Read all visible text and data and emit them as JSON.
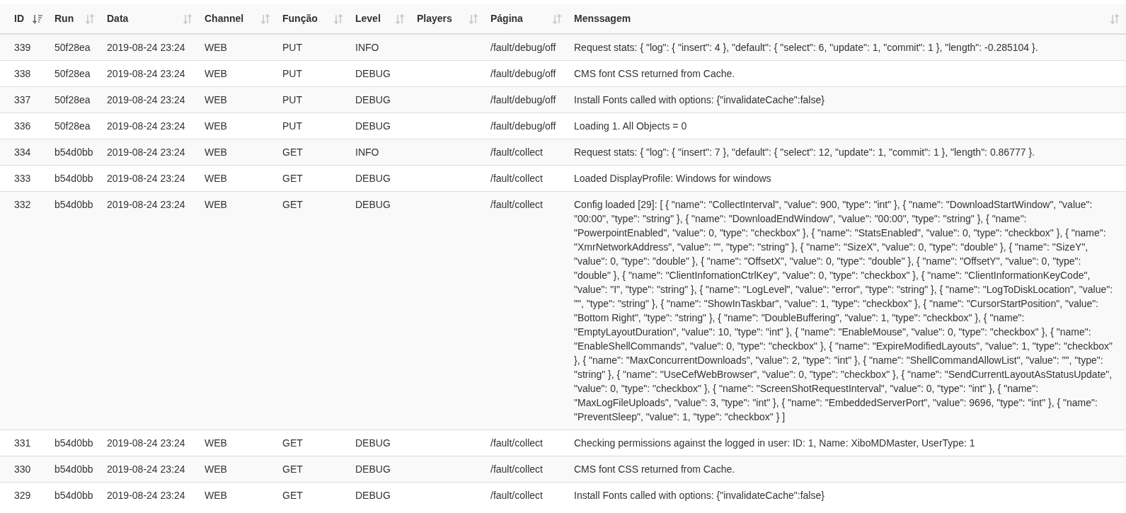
{
  "table": {
    "columns": [
      {
        "label": "ID",
        "sorted": true
      },
      {
        "label": "Run",
        "sorted": false
      },
      {
        "label": "Data",
        "sorted": false
      },
      {
        "label": "Channel",
        "sorted": false
      },
      {
        "label": "Função",
        "sorted": false
      },
      {
        "label": "Level",
        "sorted": false
      },
      {
        "label": "Players",
        "sorted": false
      },
      {
        "label": "Página",
        "sorted": false
      },
      {
        "label": "Menssagem",
        "sorted": false
      }
    ],
    "rows": [
      {
        "cells": [
          "339",
          "50f28ea",
          "2019-08-24 23:24",
          "WEB",
          "PUT",
          "INFO",
          "",
          "/fault/debug/off",
          "Request stats: { \"log\": { \"insert\": 4 }, \"default\": { \"select\": 6, \"update\": 1, \"commit\": 1 }, \"length\": -0.285104 }."
        ]
      },
      {
        "cells": [
          "338",
          "50f28ea",
          "2019-08-24 23:24",
          "WEB",
          "PUT",
          "DEBUG",
          "",
          "/fault/debug/off",
          "CMS font CSS returned from Cache."
        ]
      },
      {
        "cells": [
          "337",
          "50f28ea",
          "2019-08-24 23:24",
          "WEB",
          "PUT",
          "DEBUG",
          "",
          "/fault/debug/off",
          "Install Fonts called with options: {\"invalidateCache\":false}"
        ]
      },
      {
        "cells": [
          "336",
          "50f28ea",
          "2019-08-24 23:24",
          "WEB",
          "PUT",
          "DEBUG",
          "",
          "/fault/debug/off",
          "Loading 1. All Objects = 0"
        ]
      },
      {
        "cells": [
          "334",
          "b54d0bb",
          "2019-08-24 23:24",
          "WEB",
          "GET",
          "INFO",
          "",
          "/fault/collect",
          "Request stats: { \"log\": { \"insert\": 7 }, \"default\": { \"select\": 12, \"update\": 1, \"commit\": 1 }, \"length\": 0.86777 }."
        ]
      },
      {
        "cells": [
          "333",
          "b54d0bb",
          "2019-08-24 23:24",
          "WEB",
          "GET",
          "DEBUG",
          "",
          "/fault/collect",
          "Loaded DisplayProfile: Windows for windows"
        ]
      },
      {
        "cells": [
          "332",
          "b54d0bb",
          "2019-08-24 23:24",
          "WEB",
          "GET",
          "DEBUG",
          "",
          "/fault/collect",
          "Config loaded [29]: [ { \"name\": \"CollectInterval\", \"value\": 900, \"type\": \"int\" }, { \"name\": \"DownloadStartWindow\", \"value\": \"00:00\", \"type\": \"string\" }, { \"name\": \"DownloadEndWindow\", \"value\": \"00:00\", \"type\": \"string\" }, { \"name\": \"PowerpointEnabled\", \"value\": 0, \"type\": \"checkbox\" }, { \"name\": \"StatsEnabled\", \"value\": 0, \"type\": \"checkbox\" }, { \"name\": \"XmrNetworkAddress\", \"value\": \"\", \"type\": \"string\" }, { \"name\": \"SizeX\", \"value\": 0, \"type\": \"double\" }, { \"name\": \"SizeY\", \"value\": 0, \"type\": \"double\" }, { \"name\": \"OffsetX\", \"value\": 0, \"type\": \"double\" }, { \"name\": \"OffsetY\", \"value\": 0, \"type\": \"double\" }, { \"name\": \"ClientInfomationCtrlKey\", \"value\": 0, \"type\": \"checkbox\" }, { \"name\": \"ClientInformationKeyCode\", \"value\": \"I\", \"type\": \"string\" }, { \"name\": \"LogLevel\", \"value\": \"error\", \"type\": \"string\" }, { \"name\": \"LogToDiskLocation\", \"value\": \"\", \"type\": \"string\" }, { \"name\": \"ShowInTaskbar\", \"value\": 1, \"type\": \"checkbox\" }, { \"name\": \"CursorStartPosition\", \"value\": \"Bottom Right\", \"type\": \"string\" }, { \"name\": \"DoubleBuffering\", \"value\": 1, \"type\": \"checkbox\" }, { \"name\": \"EmptyLayoutDuration\", \"value\": 10, \"type\": \"int\" }, { \"name\": \"EnableMouse\", \"value\": 0, \"type\": \"checkbox\" }, { \"name\": \"EnableShellCommands\", \"value\": 0, \"type\": \"checkbox\" }, { \"name\": \"ExpireModifiedLayouts\", \"value\": 1, \"type\": \"checkbox\" }, { \"name\": \"MaxConcurrentDownloads\", \"value\": 2, \"type\": \"int\" }, { \"name\": \"ShellCommandAllowList\", \"value\": \"\", \"type\": \"string\" }, { \"name\": \"UseCefWebBrowser\", \"value\": 0, \"type\": \"checkbox\" }, { \"name\": \"SendCurrentLayoutAsStatusUpdate\", \"value\": 0, \"type\": \"checkbox\" }, { \"name\": \"ScreenShotRequestInterval\", \"value\": 0, \"type\": \"int\" }, { \"name\": \"MaxLogFileUploads\", \"value\": 3, \"type\": \"int\" }, { \"name\": \"EmbeddedServerPort\", \"value\": 9696, \"type\": \"int\" }, { \"name\": \"PreventSleep\", \"value\": 1, \"type\": \"checkbox\" } ]"
        ]
      },
      {
        "cells": [
          "331",
          "b54d0bb",
          "2019-08-24 23:24",
          "WEB",
          "GET",
          "DEBUG",
          "",
          "/fault/collect",
          "Checking permissions against the logged in user: ID: 1, Name: XiboMDMaster, UserType: 1"
        ]
      },
      {
        "cells": [
          "330",
          "b54d0bb",
          "2019-08-24 23:24",
          "WEB",
          "GET",
          "DEBUG",
          "",
          "/fault/collect",
          "CMS font CSS returned from Cache."
        ]
      },
      {
        "cells": [
          "329",
          "b54d0bb",
          "2019-08-24 23:24",
          "WEB",
          "GET",
          "DEBUG",
          "",
          "/fault/collect",
          "Install Fonts called with options: {\"invalidateCache\":false}"
        ]
      }
    ]
  }
}
